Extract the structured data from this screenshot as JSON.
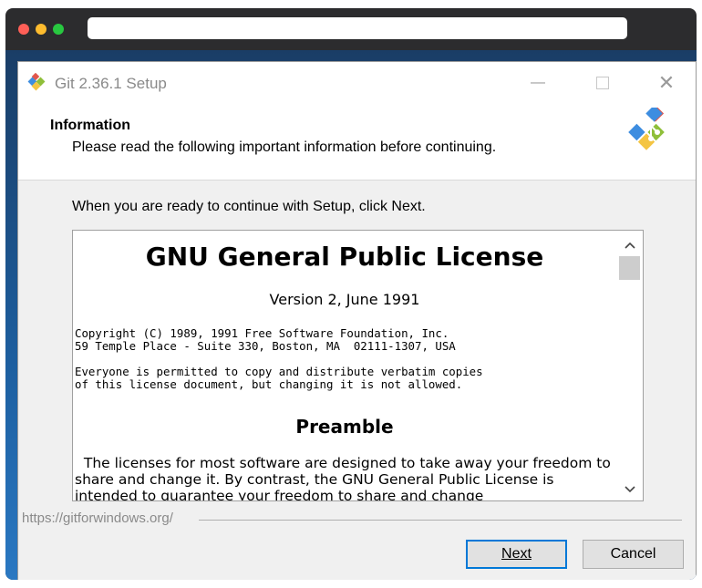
{
  "window": {
    "title": "Git 2.36.1 Setup"
  },
  "header": {
    "title": "Information",
    "subtitle": "Please read the following important information before continuing."
  },
  "prompt": "When you are ready to continue with Setup, click Next.",
  "license": {
    "heading": "GNU General Public License",
    "version": "Version 2, June 1991",
    "copyright_line1": "Copyright (C) 1989, 1991 Free Software Foundation, Inc.",
    "copyright_line2": "59 Temple Place - Suite 330, Boston, MA  02111-1307, USA",
    "notice_line1": "Everyone is permitted to copy and distribute verbatim copies",
    "notice_line2": "of this license document, but changing it is not allowed.",
    "preamble_heading": "Preamble",
    "preamble_text": "  The licenses for most software are designed to take away your freedom to share and change it. By contrast, the GNU General Public License is intended to guarantee your freedom to share and change"
  },
  "footer": {
    "link": "https://gitforwindows.org/"
  },
  "buttons": {
    "next": "Next",
    "cancel": "Cancel"
  },
  "icons": {
    "app": "git-logo-icon",
    "minimize": "minimize-icon",
    "maximize": "maximize-icon",
    "close": "close-icon",
    "scroll_up": "chevron-up-icon",
    "scroll_down": "chevron-down-icon"
  },
  "colors": {
    "accent": "#0078d7",
    "logo_red": "#e2574c",
    "logo_blue": "#3d8de0",
    "logo_green": "#8fbf3a",
    "logo_yellow": "#f4c542"
  }
}
